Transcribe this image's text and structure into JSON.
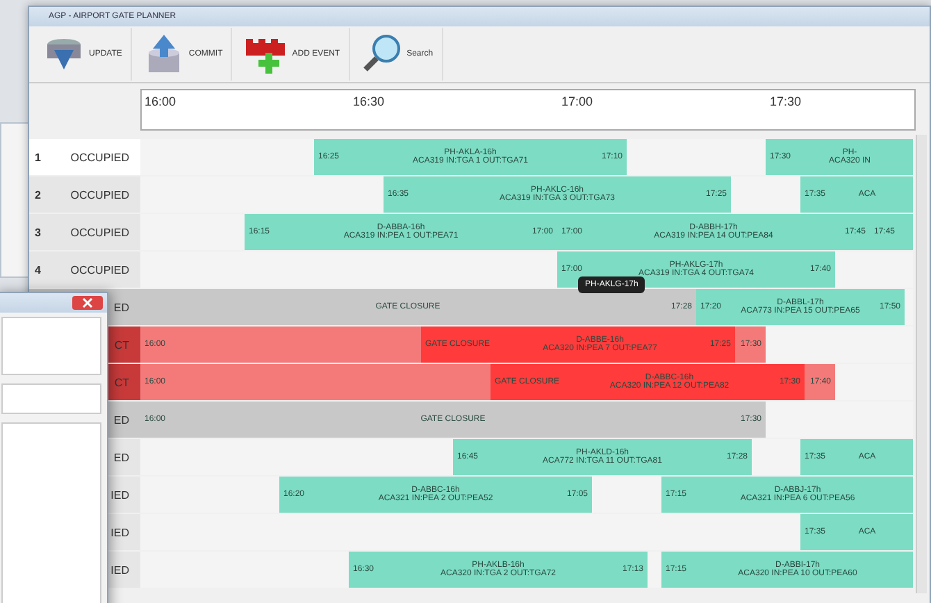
{
  "window": {
    "title": "AGP - AIRPORT GATE PLANNER"
  },
  "toolbar": [
    {
      "kind": "update",
      "label": "UPDATE"
    },
    {
      "kind": "commit",
      "label": "COMMIT"
    },
    {
      "kind": "add",
      "label": "ADD EVENT"
    },
    {
      "kind": "search",
      "label": "Search"
    }
  ],
  "timescale": [
    "16:00",
    "16:30",
    "17:00",
    "17:30"
  ],
  "rows": [
    {
      "number": "1",
      "status": "OCCUPIED",
      "kind": "occupied",
      "selected": true,
      "events": [
        {
          "kind": "flight",
          "start": "16:25",
          "end": "17:10",
          "title": "PH-AKLA-16h",
          "subtitle": "ACA319 IN:TGA 1 OUT:TGA71"
        },
        {
          "kind": "flight",
          "start": "17:30",
          "title": "PH-",
          "subtitle": "ACA320 IN"
        }
      ]
    },
    {
      "number": "2",
      "status": "OCCUPIED",
      "kind": "occupied",
      "selected": false,
      "events": [
        {
          "kind": "flight",
          "start": "16:35",
          "end": "17:25",
          "title": "PH-AKLC-16h",
          "subtitle": "ACA319 IN:TGA 3 OUT:TGA73"
        },
        {
          "kind": "flight",
          "start": "17:35",
          "subtitle": "ACA"
        }
      ]
    },
    {
      "number": "3",
      "status": "OCCUPIED",
      "kind": "occupied",
      "selected": false,
      "events": [
        {
          "kind": "flight",
          "start": "16:15",
          "end": "17:00",
          "title": "D-ABBA-16h",
          "subtitle": "ACA319 IN:PEA 1 OUT:PEA71"
        },
        {
          "kind": "flight",
          "start": "17:00",
          "end": "17:45",
          "title": "D-ABBH-17h",
          "subtitle": "ACA319 IN:PEA 14 OUT:PEA84"
        },
        {
          "kind": "flight",
          "start": "17:45"
        }
      ]
    },
    {
      "number": "4",
      "status": "OCCUPIED",
      "kind": "occupied",
      "selected": false,
      "events": [
        {
          "kind": "flight",
          "start": "17:00",
          "end": "17:40",
          "title": "PH-AKLG-17h",
          "subtitle": "ACA319 IN:TGA 4 OUT:TGA74"
        }
      ]
    },
    {
      "status": "ED",
      "kind": "closure",
      "selected": false,
      "events": [
        {
          "kind": "closure",
          "end": "17:28",
          "label": "GATE CLOSURE"
        },
        {
          "kind": "flight",
          "start": "17:20",
          "end": "17:50",
          "title": "D-ABBL-17h",
          "subtitle": "ACA773 IN:PEA 15 OUT:PEA65"
        }
      ]
    },
    {
      "status": "CT",
      "kind": "conflict",
      "selected": false,
      "events": [
        {
          "kind": "conflict-closure",
          "start": "16:00",
          "end": "17:30",
          "overlap": {
            "label": "GATE CLOSURE",
            "title": "D-ABBE-16h",
            "subtitle": "ACA320 IN:PEA 7 OUT:PEA77",
            "end": "17:25"
          }
        }
      ]
    },
    {
      "status": "CT",
      "kind": "conflict",
      "selected": false,
      "events": [
        {
          "kind": "conflict-closure",
          "start": "16:00",
          "end": "17:40",
          "overlap": {
            "label": "GATE CLOSURE",
            "title": "D-ABBC-16h",
            "subtitle": "ACA320 IN:PEA 12 OUT:PEA82",
            "end": "17:30"
          }
        }
      ]
    },
    {
      "status": "ED",
      "kind": "closure",
      "selected": false,
      "events": [
        {
          "kind": "closure",
          "start": "16:00",
          "end": "17:30",
          "label": "GATE CLOSURE"
        }
      ]
    },
    {
      "status": "ED",
      "kind": "occupied",
      "selected": false,
      "events": [
        {
          "kind": "flight",
          "start": "16:45",
          "end": "17:28",
          "title": "PH-AKLD-16h",
          "subtitle": "ACA772 IN:TGA 11 OUT:TGA81"
        },
        {
          "kind": "flight",
          "start": "17:35",
          "subtitle": "ACA"
        }
      ]
    },
    {
      "status": "IED",
      "kind": "occupied",
      "selected": false,
      "events": [
        {
          "kind": "flight",
          "start": "16:20",
          "end": "17:05",
          "title": "D-ABBC-16h",
          "subtitle": "ACA321 IN:PEA 2 OUT:PEA52"
        },
        {
          "kind": "flight",
          "start": "17:15",
          "title": "D-ABBJ-17h",
          "subtitle": "ACA321 IN:PEA 6 OUT:PEA56"
        }
      ]
    },
    {
      "status": "IED",
      "kind": "occupied",
      "selected": false,
      "events": [
        {
          "kind": "flight",
          "start": "17:35",
          "subtitle": "ACA"
        }
      ]
    },
    {
      "status": "IED",
      "kind": "occupied",
      "selected": false,
      "events": [
        {
          "kind": "flight",
          "start": "16:30",
          "end": "17:13",
          "title": "PH-AKLB-16h",
          "subtitle": "ACA320 IN:TGA 2 OUT:TGA72"
        },
        {
          "kind": "flight",
          "start": "17:15",
          "title": "D-ABBI-17h",
          "subtitle": "ACA320 IN:PEA 10 OUT:PEA60"
        }
      ]
    }
  ],
  "tooltip": {
    "text": "PH-AKLG-17h"
  }
}
